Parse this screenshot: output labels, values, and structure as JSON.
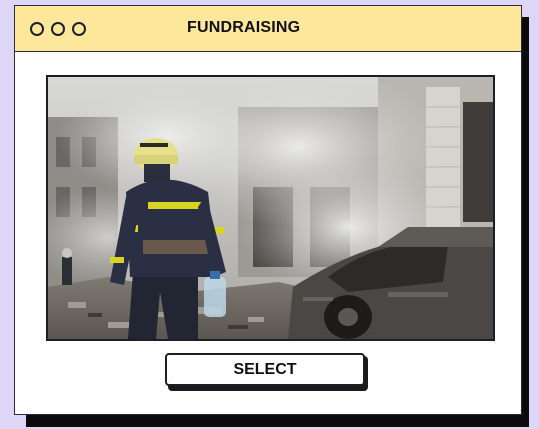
{
  "window": {
    "title": "FUNDRAISING",
    "controls": [
      "circle-icon",
      "circle-icon",
      "circle-icon"
    ]
  },
  "image": {
    "subject": "firefighter-photo"
  },
  "actions": {
    "select_label": "SELECT"
  },
  "colors": {
    "background": "#ddd6f7",
    "titlebar": "#fde79a",
    "window": "#ffffff",
    "outline": "#1e1e2a"
  }
}
